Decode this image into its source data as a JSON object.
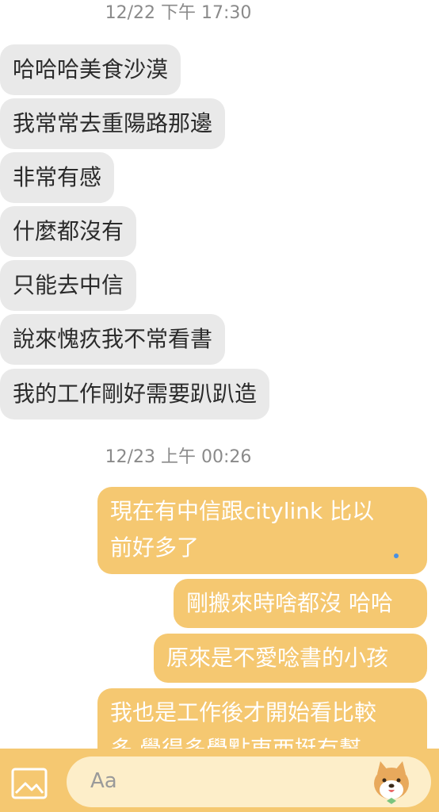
{
  "timestamps": {
    "first": "12/22 下午 17:30",
    "second": "12/23 上午 00:26"
  },
  "incoming": [
    "哈哈哈美食沙漠",
    "我常常去重陽路那邊",
    "非常有感",
    "什麼都沒有",
    "只能去中信",
    "說來愧疚我不常看書",
    "我的工作剛好需要趴趴造"
  ],
  "outgoing": {
    "m1_line1": "現在有中信跟citylink 比以",
    "m1_line2": "前好多了",
    "m2": "剛搬來時啥都沒 哈哈",
    "m3": "原來是不愛唸書的小孩",
    "m4_line1": "我也是工作後才開始看比較",
    "m4_line2": "多 覺得多學點東西挺有幫"
  },
  "composer": {
    "placeholder": "Aa",
    "image_icon": "image-icon",
    "sticker_icon": "shiba-sticker-icon"
  },
  "colors": {
    "outgoing_bubble": "#f5c871",
    "incoming_bubble": "#e9e9e9",
    "composer_bar": "#f5c871"
  }
}
